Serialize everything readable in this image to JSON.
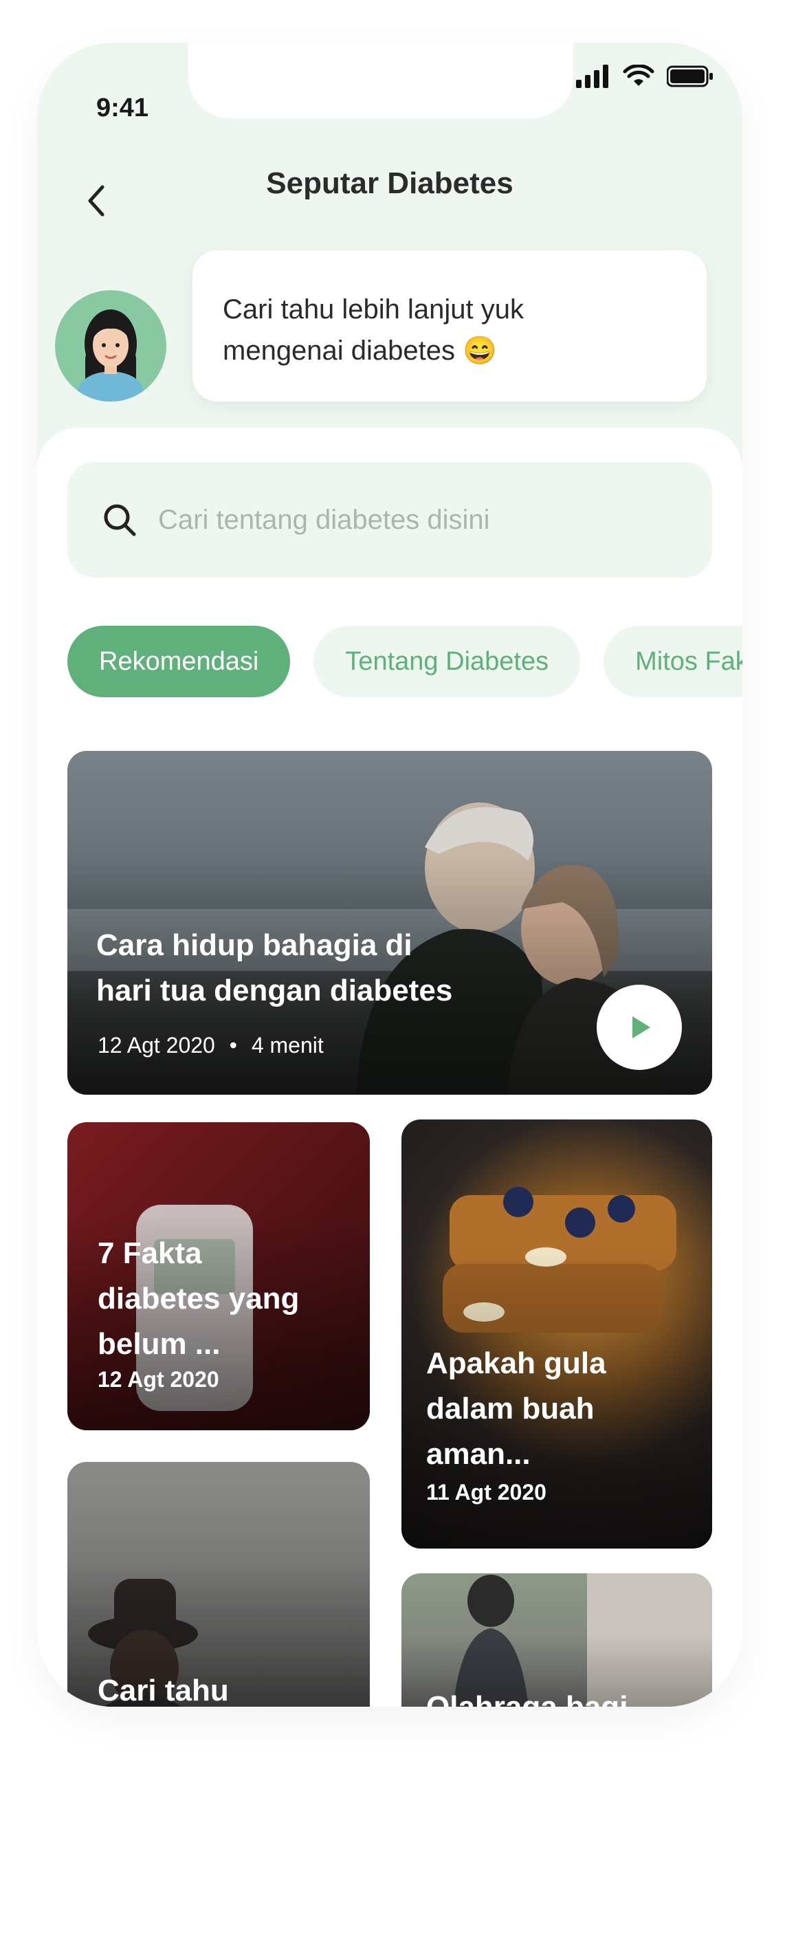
{
  "status_bar": {
    "time": "9:41"
  },
  "header": {
    "title": "Seputar Diabetes"
  },
  "assistant": {
    "message_line1": "Cari tahu lebih lanjut yuk",
    "message_line2": "mengenai diabetes 😄"
  },
  "search": {
    "placeholder": "Cari tentang diabetes disini"
  },
  "chips": [
    {
      "label": "Rekomendasi",
      "active": true
    },
    {
      "label": "Tentang Diabetes",
      "active": false
    },
    {
      "label": "Mitos Fakta",
      "active": false
    }
  ],
  "featured": {
    "title_line1": "Cara hidup bahagia di",
    "title_line2": "hari tua dengan diabetes",
    "date": "12 Agt 2020",
    "duration": "4 menit"
  },
  "articles": [
    {
      "title_line1": "7 Fakta",
      "title_line2": "diabetes yang",
      "title_line3": "belum ...",
      "date": "12 Agt 2020"
    },
    {
      "title_line1": "Apakah gula",
      "title_line2": "dalam buah",
      "title_line3": "aman...",
      "date": "11 Agt 2020"
    },
    {
      "title_line1": "Cari tahu"
    },
    {
      "title_line1": "Olahraga bagi"
    }
  ],
  "colors": {
    "accent": "#5fb07a",
    "background_tint": "#eef6f0"
  }
}
